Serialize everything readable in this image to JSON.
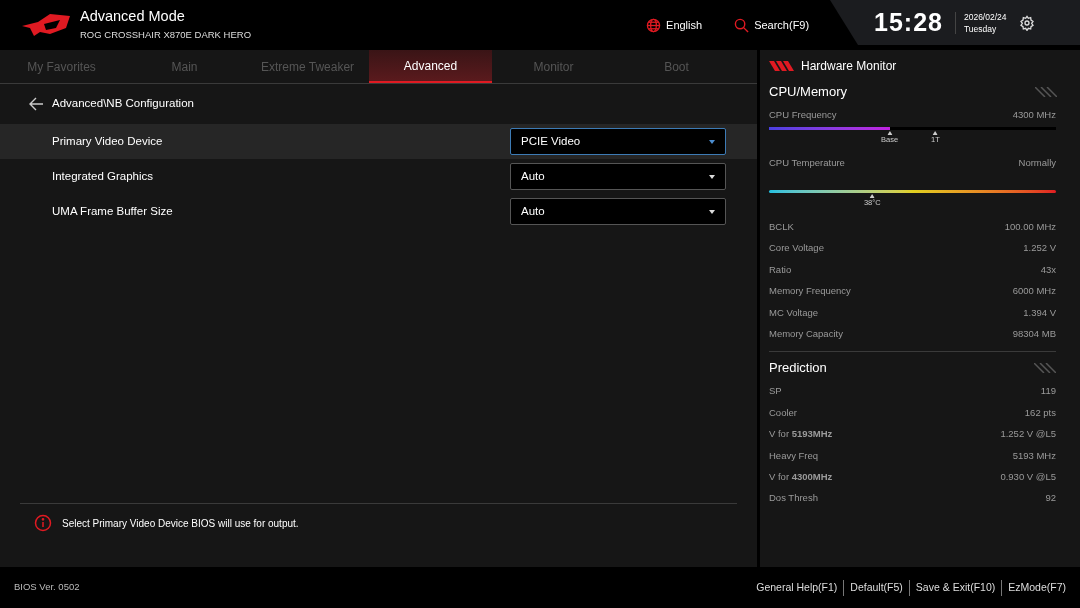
{
  "header": {
    "title": "Advanced Mode",
    "model": "ROG CROSSHAIR X870E DARK HERO",
    "language": "English",
    "search": "Search(F9)",
    "time": "15:28",
    "date": "2026/02/24",
    "weekday": "Tuesday"
  },
  "tabs": [
    {
      "label": "My Favorites",
      "selected": false
    },
    {
      "label": "Main",
      "selected": false
    },
    {
      "label": "Extreme Tweaker",
      "selected": false
    },
    {
      "label": "Advanced",
      "selected": true
    },
    {
      "label": "Monitor",
      "selected": false
    },
    {
      "label": "Boot",
      "selected": false
    }
  ],
  "breadcrumb": "Advanced\\NB Configuration",
  "settings": [
    {
      "label": "Primary Video Device",
      "value": "PCIE Video",
      "selected": true
    },
    {
      "label": "Integrated Graphics",
      "value": "Auto",
      "selected": false
    },
    {
      "label": "UMA Frame Buffer Size",
      "value": "Auto",
      "selected": false
    }
  ],
  "help_text": "Select Primary Video Device BIOS will use for output.",
  "hardware_monitor": {
    "title": "Hardware Monitor",
    "cpu_memory": {
      "title": "CPU/Memory",
      "cpu_frequency": {
        "label": "CPU Frequency",
        "reading": "4300 MHz",
        "level": 0.42,
        "markers": [
          "Base",
          "1T"
        ]
      },
      "cpu_temperature": {
        "label": "CPU Temperature",
        "reading": "Normally",
        "level": 0.36,
        "marker": "38°C"
      },
      "rows": [
        {
          "label": "BCLK",
          "value": "100.00 MHz"
        },
        {
          "label": "Core Voltage",
          "value": "1.252 V"
        },
        {
          "label": "Ratio",
          "value": "43x"
        },
        {
          "label": "Memory Frequency",
          "value": "6000 MHz"
        },
        {
          "label": "MC Voltage",
          "value": "1.394 V"
        },
        {
          "label": "Memory Capacity",
          "value": "98304 MB"
        }
      ]
    },
    "prediction": {
      "title": "Prediction",
      "rows": [
        {
          "label": "SP",
          "value": "119"
        },
        {
          "label": "Cooler",
          "value": "162 pts"
        },
        {
          "label": "V for **5193MHz**",
          "value": "1.252 V @L5"
        },
        {
          "label": "Heavy Freq",
          "value": "5193 MHz"
        },
        {
          "label": "V for **4300MHz**",
          "value": "0.930 V @L5"
        },
        {
          "label": "Dos Thresh",
          "value": "92"
        }
      ]
    }
  },
  "footer": {
    "version": "BIOS Ver. 0502",
    "actions": [
      "General Help(F1)",
      "Default(F5)",
      "Save & Exit(F10)",
      "EzMode(F7)"
    ]
  }
}
